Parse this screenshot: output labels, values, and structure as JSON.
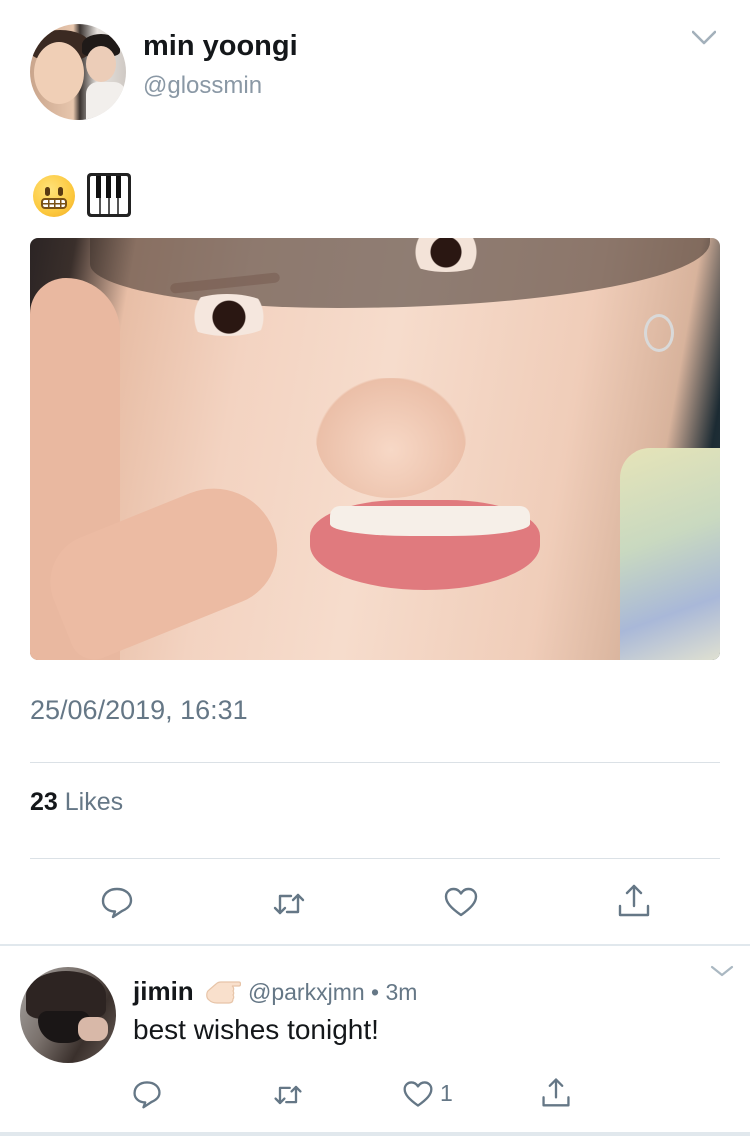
{
  "tweet": {
    "display_name": "min yoongi",
    "handle": "@glossmin",
    "emojis": [
      "grimacing-face",
      "musical-keyboard"
    ],
    "timestamp": "25/06/2019, 16:31",
    "likes_count": "23",
    "likes_label": "Likes"
  },
  "reply": {
    "display_name": "jimin",
    "name_emoji": "backhand-index-pointing-left",
    "handle": "@parkxjmn",
    "separator": "•",
    "time": "3m",
    "text": "best wishes tonight!",
    "like_count": "1"
  },
  "icons": {
    "more": "chevron-down-icon",
    "reply": "reply-icon",
    "retweet": "retweet-icon",
    "like": "heart-icon",
    "share": "share-icon"
  },
  "colors": {
    "icon_gray": "#657786",
    "text": "#14171a",
    "secondary": "#657786",
    "divider": "#dbe1e6"
  }
}
